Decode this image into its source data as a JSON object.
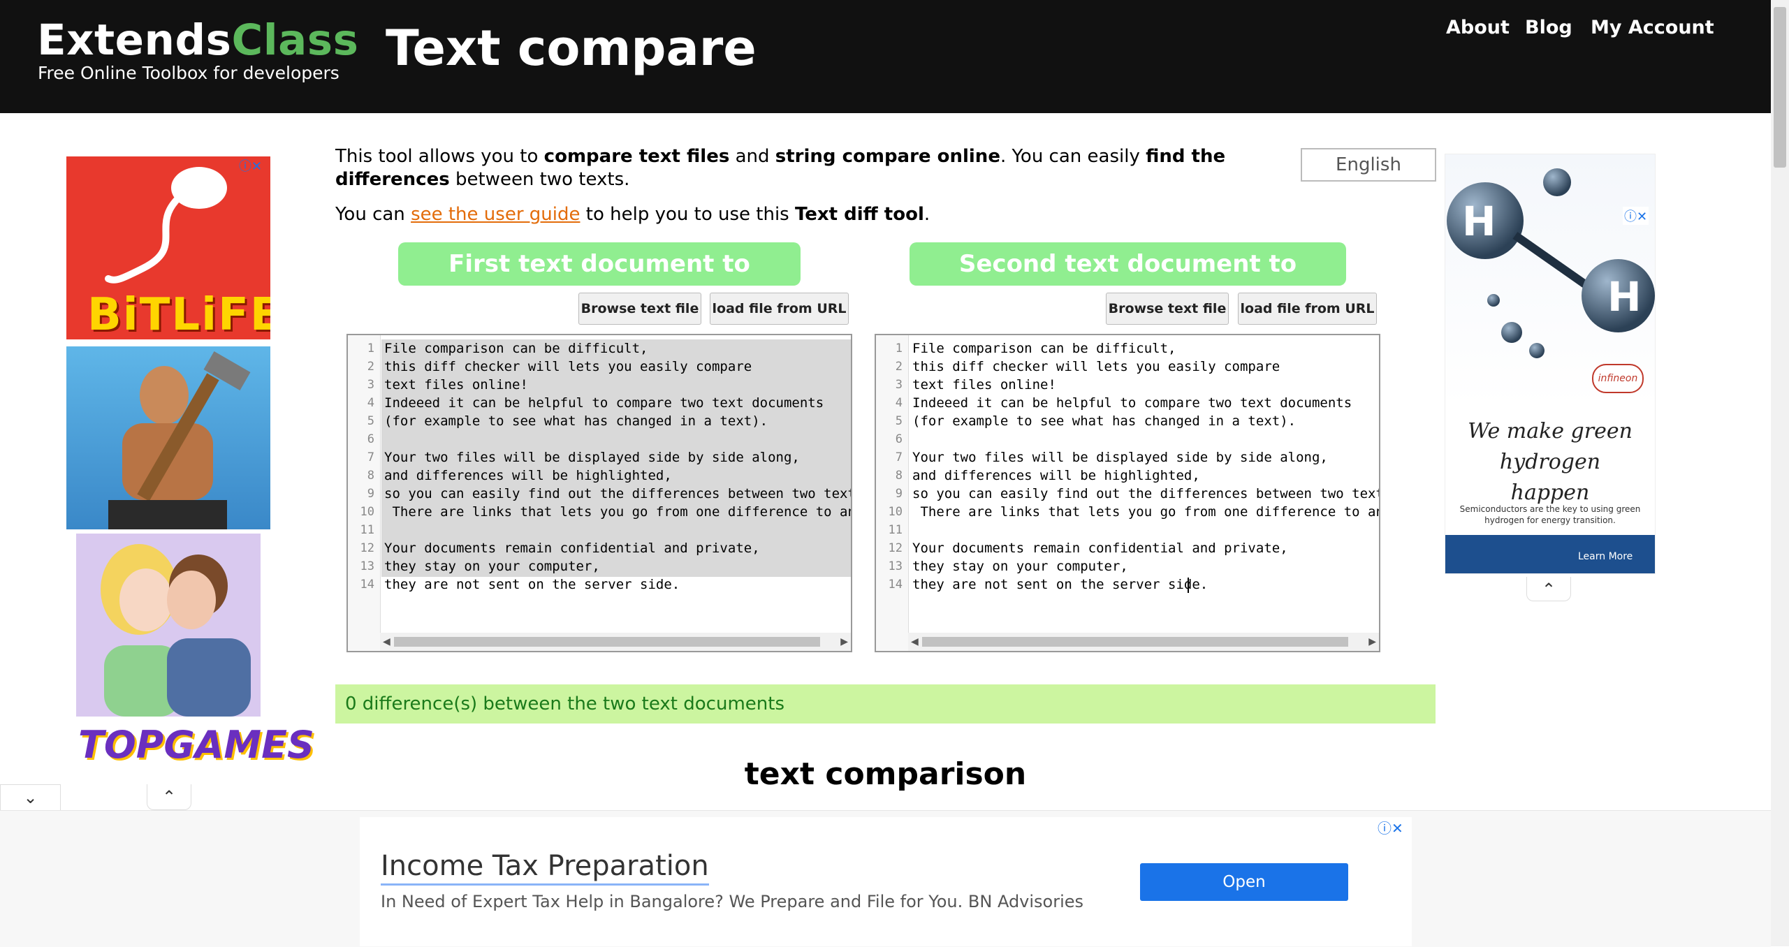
{
  "header": {
    "logo_main_1": "Extends",
    "logo_main_2": "Class",
    "logo_sub": "Free Online Toolbox for developers",
    "title": "Text compare",
    "nav": [
      "About",
      "Blog",
      "My Account"
    ]
  },
  "intro": {
    "p1_a": "This tool allows you to ",
    "p1_b": "compare text files",
    "p1_c": " and ",
    "p1_d": "string compare online",
    "p1_e": ". You can easily ",
    "p1_f": "find the differences",
    "p1_g": " between two texts.",
    "p2_a": "You can ",
    "p2_link": "see the user guide",
    "p2_b": " to help you to use this ",
    "p2_c": "Text diff tool",
    "p2_d": "."
  },
  "language": "English",
  "editor1": {
    "heading": "First text document to compare",
    "browse_label": "Browse text file",
    "url_label": "load file from URL"
  },
  "editor2": {
    "heading": "Second text document to compare",
    "browse_label": "Browse text file",
    "url_label": "load file from URL"
  },
  "lines": [
    "File comparison can be difficult,",
    "this diff checker will lets you easily compare",
    "text files online!",
    "Indeeed it can be helpful to compare two text documents",
    "(for example to see what has changed in a text).",
    "",
    "Your two files will be displayed side by side along,",
    "and differences will be highlighted,",
    "so you can easily find out the differences between two texts.",
    " There are links that lets you go from one difference to anoth",
    "",
    "Your documents remain confidential and private,",
    "they stay on your computer,",
    "they are not sent on the server side."
  ],
  "result": "0 difference(s) between the two text documents",
  "section_title": "text comparison",
  "ads": {
    "left_game1": "BiTLiFE",
    "left_game_footer": "TOPGAMES",
    "right_h": "H",
    "right_brand": "infineon",
    "right_slogan": "We make green hydrogen happen",
    "right_small": "Semiconductors are the key to using green hydrogen for energy transition.",
    "right_cta": "Learn More",
    "bottom_title": "Income Tax Preparation",
    "bottom_desc": "In Need of Expert Tax Help in Bangalore? We Prepare and File for You. BN Advisories",
    "bottom_cta": "Open"
  }
}
